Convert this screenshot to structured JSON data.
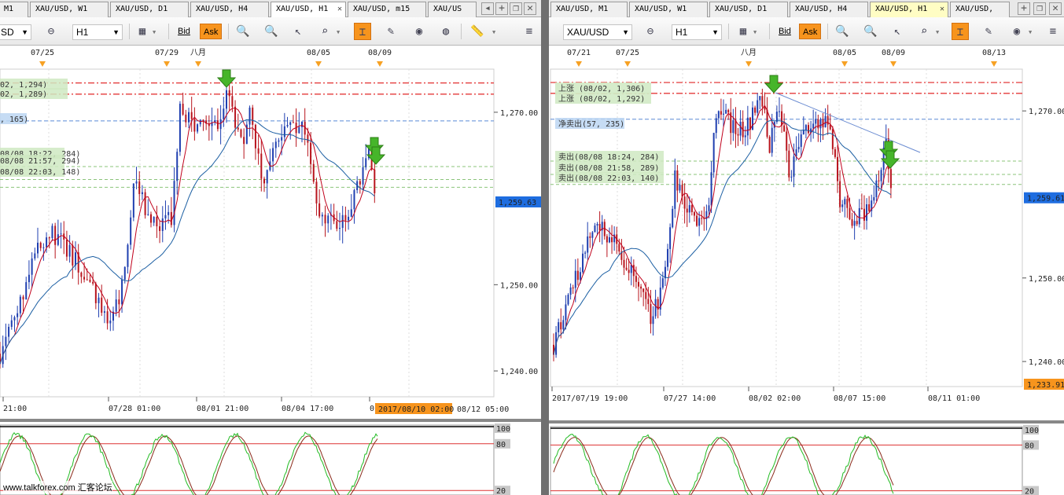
{
  "left": {
    "tabs": [
      "M1",
      "XAU/USD,  W1",
      "XAU/USD,  D1",
      "XAU/USD,  H4",
      "XAU/USD,  H1",
      "XAU/USD,  m15",
      "XAU/US"
    ],
    "active_tab_index": 4,
    "toolbar": {
      "symbol": "SD",
      "timeframe": "H1",
      "bid_label": "Bid",
      "ask_label": "Ask"
    },
    "top_dates": [
      "07/25",
      "07/29",
      "八月",
      "08/05",
      "08/09"
    ],
    "overlays": [
      "02,  1,294)",
      "02,  1,289)",
      ", 165)",
      "08/08 18:22, 284)",
      "08/08 21:57, 294)",
      "08/08 22:03, 148)"
    ],
    "price_axis": [
      "1,270.00",
      "1,250.00",
      "1,240.00"
    ],
    "current_price": "1,259.63",
    "time_axis": [
      "21:00",
      "07/28 01:00",
      "08/01 21:00",
      "08/04 17:00",
      "0"
    ],
    "time_highlight": "2017/08/10 02:00",
    "time_axis_right": "08/12 05:00",
    "osc_axis": [
      "100",
      "80",
      "20"
    ]
  },
  "right": {
    "tabs": [
      "XAU/USD,  M1",
      "XAU/USD,  W1",
      "XAU/USD,  D1",
      "XAU/USD,  H4",
      "XAU/USD,  H1",
      "XAU/USD,"
    ],
    "active_tab_index": 4,
    "toolbar": {
      "symbol": "XAU/USD",
      "timeframe": "H1",
      "bid_label": "Bid",
      "ask_label": "Ask"
    },
    "top_dates": [
      "07/21",
      "07/25",
      "八月",
      "08/05",
      "08/09",
      "08/13"
    ],
    "overlays": [
      "上涨 (08/02,  1,306)",
      "上涨 (08/02,  1,292)",
      "净卖出(57, 235)",
      "卖出(08/08 18:24, 284)",
      "卖出(08/08 21:58, 289)",
      "卖出(08/08 22:03, 140)"
    ],
    "price_axis": [
      "1,270.00",
      "1,250.00",
      "1,240.00"
    ],
    "current_price": "1,259.61",
    "low_price": "1,233.91",
    "time_axis": [
      "2017/07/19 19:00",
      "07/27 14:00",
      "08/02 02:00",
      "08/07 15:00",
      "08/11 01:00"
    ],
    "osc_axis": [
      "100",
      "80",
      "20"
    ]
  },
  "watermark": "www.talkforex.com 汇客论坛",
  "colors": {
    "bull": "#1f3fb0",
    "bear": "#b8141d",
    "ma_fast": "#c0001b",
    "ma_slow": "#1c5fa3",
    "accent": "#f7941d",
    "osc_fast": "#22bb22",
    "osc_slow": "#8a2a1a"
  }
}
